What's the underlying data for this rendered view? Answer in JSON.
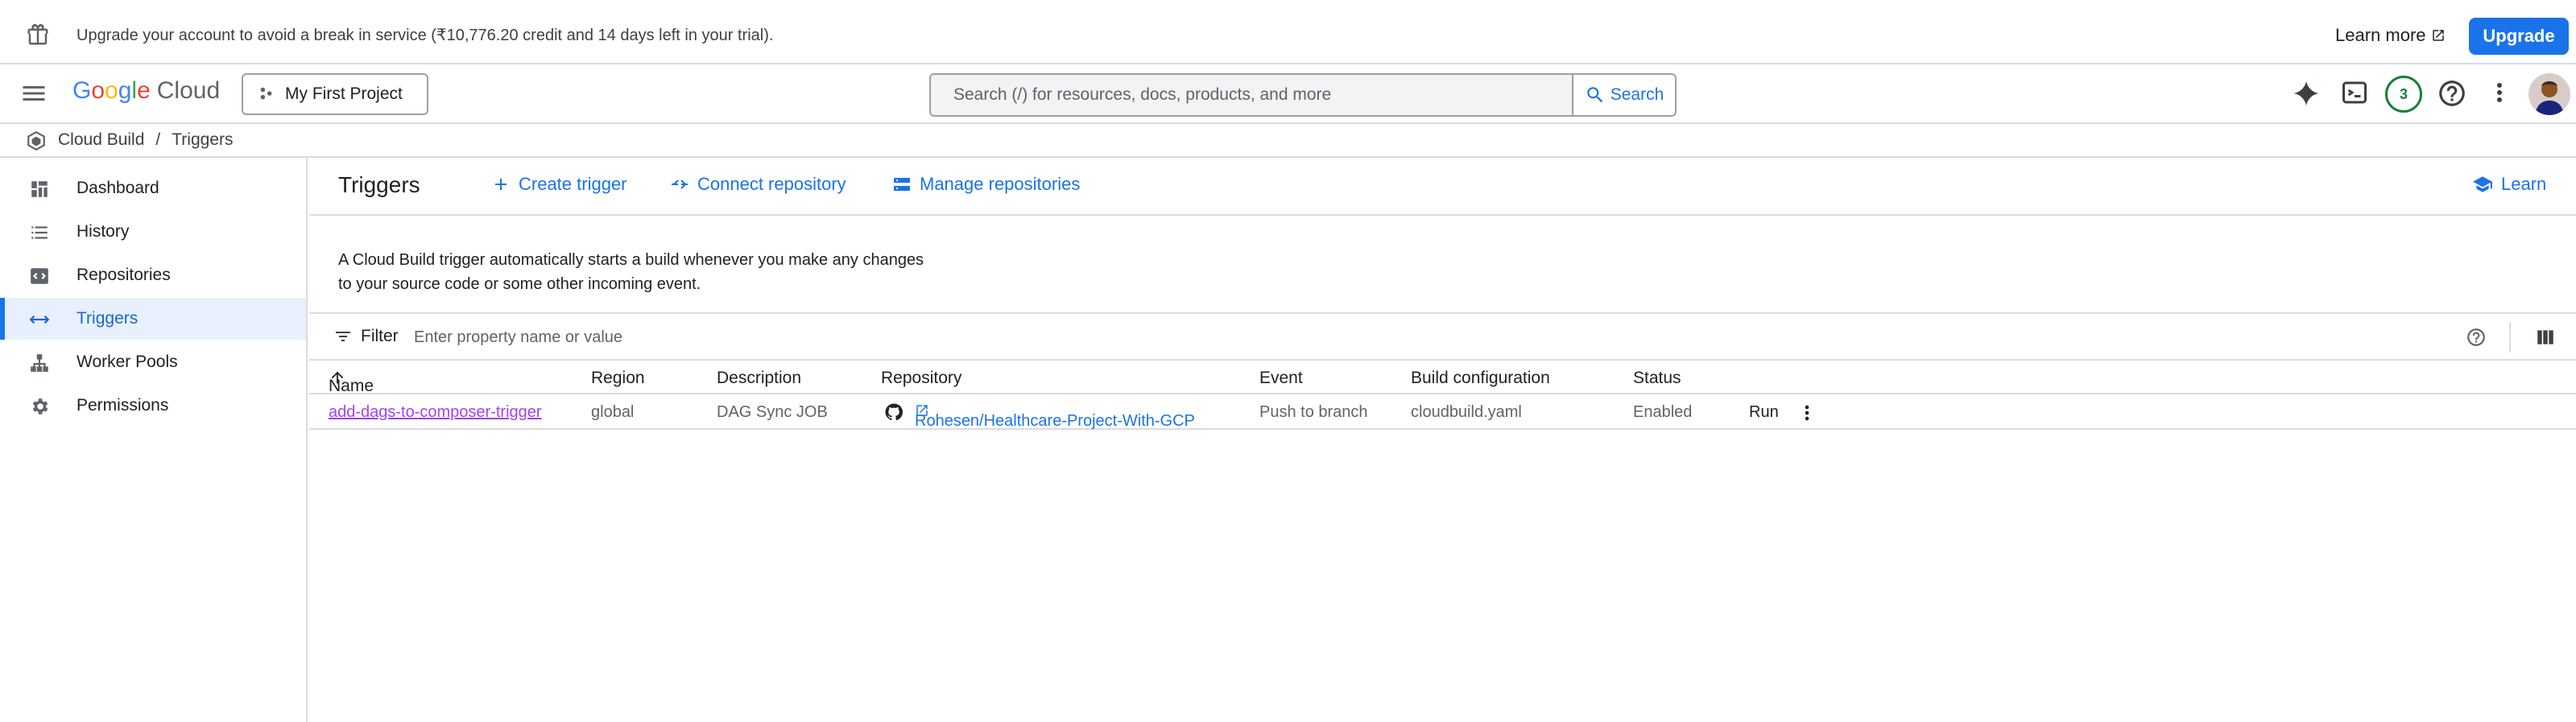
{
  "banner": {
    "message": "Upgrade your account to avoid a break in service (₹10,776.20 credit and 14 days left in your trial).",
    "learn_more": "Learn more",
    "upgrade_label": "Upgrade"
  },
  "header": {
    "logo_text": "Google",
    "logo_suffix": "Cloud",
    "project": "My First Project",
    "search_placeholder": "Search (/) for resources, docs, products, and more",
    "search_label": "Search",
    "notification_count": "3"
  },
  "breadcrumb": {
    "service": "Cloud Build",
    "separator": "/",
    "page": "Triggers"
  },
  "sidebar": {
    "items": [
      {
        "label": "Dashboard",
        "icon": "dashboard-icon"
      },
      {
        "label": "History",
        "icon": "list-icon"
      },
      {
        "label": "Repositories",
        "icon": "code-box-icon"
      },
      {
        "label": "Triggers",
        "icon": "arrows-icon",
        "active": true
      },
      {
        "label": "Worker Pools",
        "icon": "hierarchy-icon"
      },
      {
        "label": "Permissions",
        "icon": "gear-icon"
      }
    ]
  },
  "main": {
    "title": "Triggers",
    "create_trigger": "Create trigger",
    "connect_repository": "Connect repository",
    "manage_repositories": "Manage repositories",
    "learn": "Learn",
    "description_line1": "A Cloud Build trigger automatically starts a build whenever you make any changes",
    "description_line2": "to your source code or some other incoming event.",
    "filter_label": "Filter",
    "filter_placeholder": "Enter property name or value"
  },
  "table": {
    "columns": [
      "Name",
      "Region",
      "Description",
      "Repository",
      "Event",
      "Build configuration",
      "Status"
    ],
    "rows": [
      {
        "name": "add-dags-to-composer-trigger",
        "region": "global",
        "description": "DAG Sync JOB",
        "repository": "Rohesen/Healthcare-Project-With-GCP",
        "event": "Push to branch",
        "build_config": "cloudbuild.yaml",
        "status": "Enabled",
        "action": "Run"
      }
    ]
  },
  "colors": {
    "accent": "#1a73e8",
    "active_bg": "#e8f0fe",
    "visited_link": "#a142f4",
    "badge": "#188038"
  }
}
